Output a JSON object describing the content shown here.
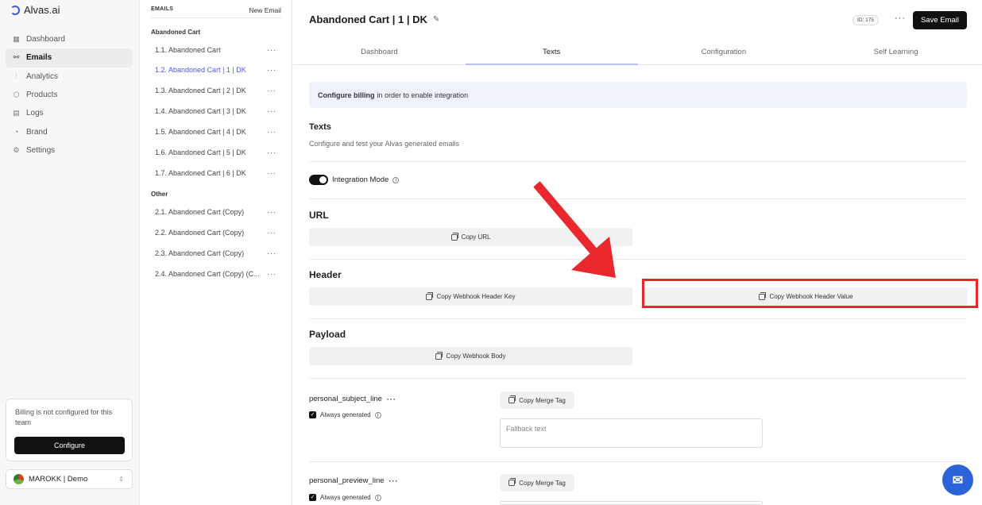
{
  "app": {
    "brand": "Alvas.ai"
  },
  "sidebar": {
    "items": [
      {
        "label": "Dashboard",
        "icon": "grid-icon"
      },
      {
        "label": "Emails",
        "icon": "share-icon",
        "active": true
      },
      {
        "label": "Analytics",
        "icon": "bar-chart-icon"
      },
      {
        "label": "Products",
        "icon": "box-icon"
      },
      {
        "label": "Logs",
        "icon": "logs-icon"
      },
      {
        "label": "Brand",
        "icon": "palette-icon"
      },
      {
        "label": "Settings",
        "icon": "gear-icon"
      }
    ],
    "billing_notice": "Billing is not configured for this team",
    "configure_label": "Configure",
    "team": "MAROKK | Demo"
  },
  "emails": {
    "header": "EMAILS",
    "new_email": "New Email",
    "groups": [
      {
        "title": "Abandoned Cart",
        "items": [
          "1.1. Abandoned Cart",
          "1.2. Abandoned Cart | 1 | DK",
          "1.3. Abandoned Cart | 2 | DK",
          "1.4. Abandoned Cart | 3 | DK",
          "1.5. Abandoned Cart | 4 | DK",
          "1.6. Abandoned Cart | 5 | DK",
          "1.7. Abandoned Cart | 6 | DK"
        ]
      },
      {
        "title": "Other",
        "items": [
          "2.1. Abandoned Cart (Copy)",
          "2.2. Abandoned Cart (Copy)",
          "2.3. Abandoned Cart (Copy)",
          "2.4. Abandoned Cart (Copy) (C..."
        ]
      }
    ]
  },
  "header": {
    "title": "Abandoned Cart | 1 | DK",
    "id_badge": "ID: 175",
    "more": "···",
    "save_label": "Save Email"
  },
  "tabs": [
    "Dashboard",
    "Texts",
    "Configuration",
    "Self Learning"
  ],
  "banner": {
    "bold": "Configure billing",
    "rest": "in order to enable integration"
  },
  "texts_section": {
    "title": "Texts",
    "description": "Configure and test your Alvas generated emails"
  },
  "integration_mode": "Integration Mode",
  "url_section": {
    "title": "URL",
    "copy_url": "Copy URL"
  },
  "header_section": {
    "title": "Header",
    "copy_key": "Copy Webhook Header Key",
    "copy_value": "Copy Webhook Header Value"
  },
  "payload_section": {
    "title": "Payload",
    "copy_body": "Copy Webhook Body"
  },
  "fields": [
    {
      "name": "personal_subject_line",
      "always_generated": "Always generated",
      "merge_label": "Copy Merge Tag",
      "fallback_placeholder": "Fallback text"
    },
    {
      "name": "personal_preview_line",
      "always_generated": "Always generated",
      "merge_label": "Copy Merge Tag"
    }
  ],
  "colors": {
    "accent": "#4b5bd8",
    "highlight": "#e8282d",
    "chat": "#2d63d8"
  }
}
